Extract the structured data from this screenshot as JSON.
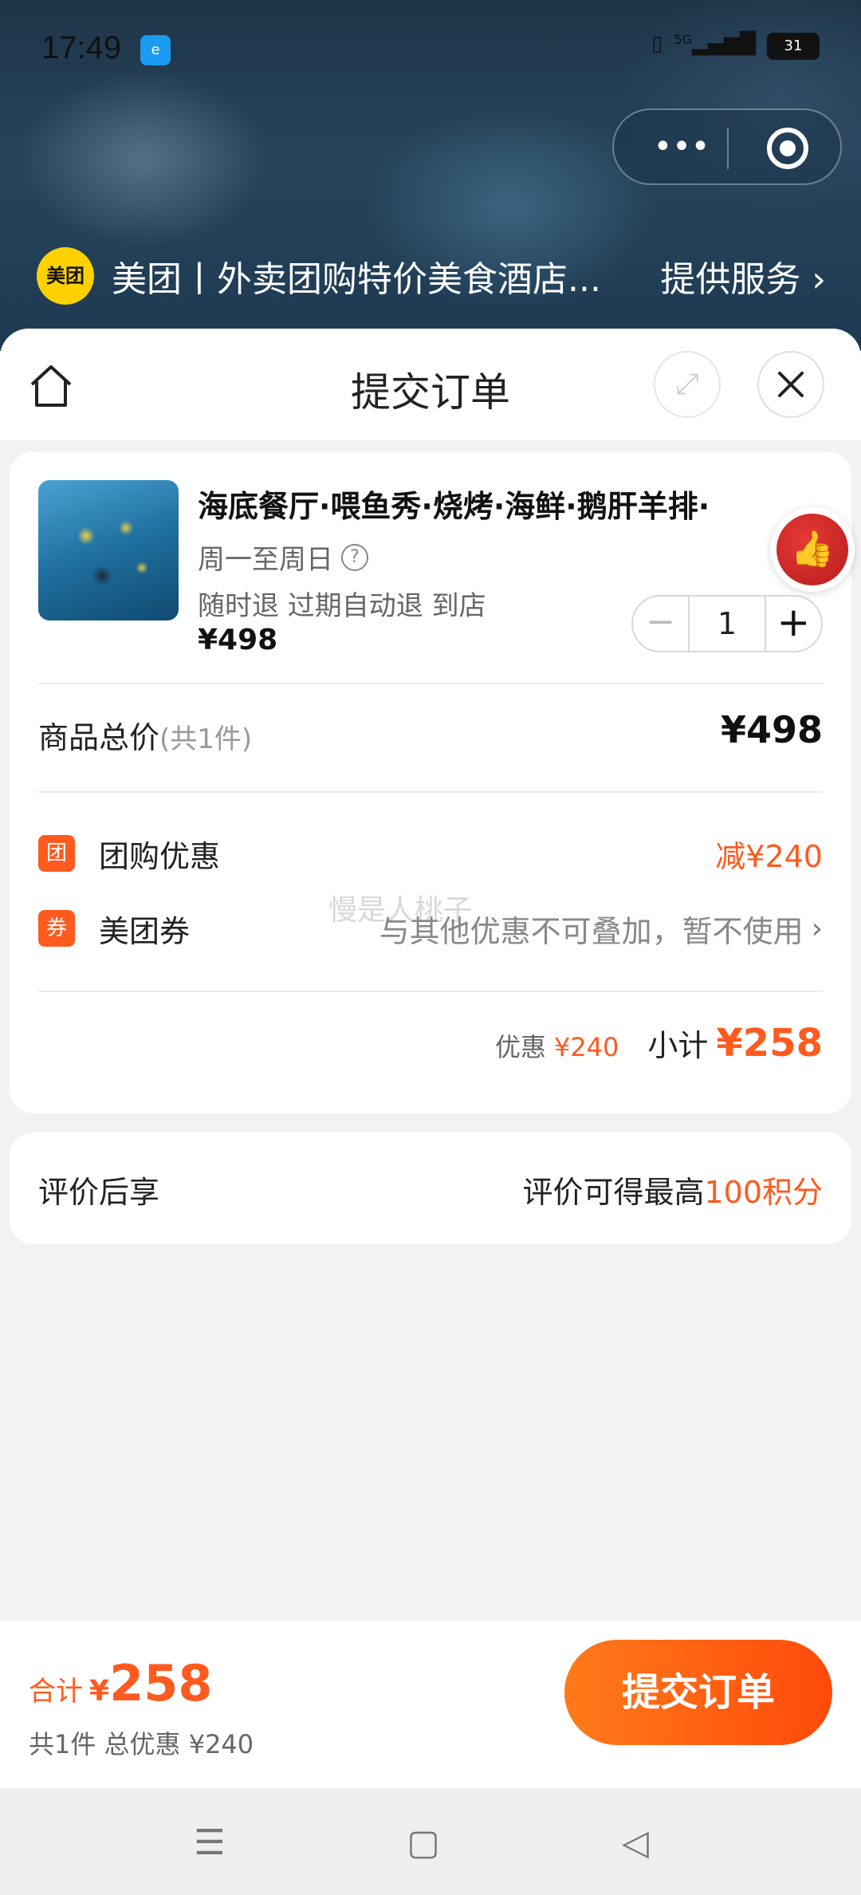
{
  "status_bar": {
    "time": "17:49",
    "app_icon_label": "",
    "network": "5G",
    "battery": "31"
  },
  "mini_program": {
    "logo_text": "美团",
    "title": "美团丨外卖团购特价美食酒店...",
    "service_link": "提供服务 ›"
  },
  "sheet": {
    "title": "提交订单"
  },
  "product": {
    "name": "海底餐厅·喂鱼秀·烧烤·海鲜·鹅肝羊排·",
    "days": "周一至周日",
    "tags": "随时退 过期自动退 到店",
    "price": "¥498",
    "quantity": "1"
  },
  "totals": {
    "label": "商品总价",
    "count": "(共1件)",
    "value": "¥498"
  },
  "promos": [
    {
      "badge": "团",
      "label": "团购优惠",
      "value": "减¥240"
    },
    {
      "badge": "券",
      "label": "美团券",
      "note": "与其他优惠不可叠加，暂不使用"
    }
  ],
  "watermark": "慢是人桃子",
  "subtotal": {
    "discount_label": "优惠",
    "discount_value": "¥240",
    "label": "小计",
    "value": "¥258"
  },
  "review": {
    "label": "评价后享",
    "note_prefix": "评价可得最高",
    "note_points": "100积分"
  },
  "bottom": {
    "sum_label": "合计",
    "sum_yen": "¥",
    "sum_value": "258",
    "sum_sub": "共1件 总优惠 ¥240",
    "submit": "提交订单"
  },
  "colors": {
    "accent": "#ff5a1f",
    "brand_yellow": "#ffd100"
  }
}
